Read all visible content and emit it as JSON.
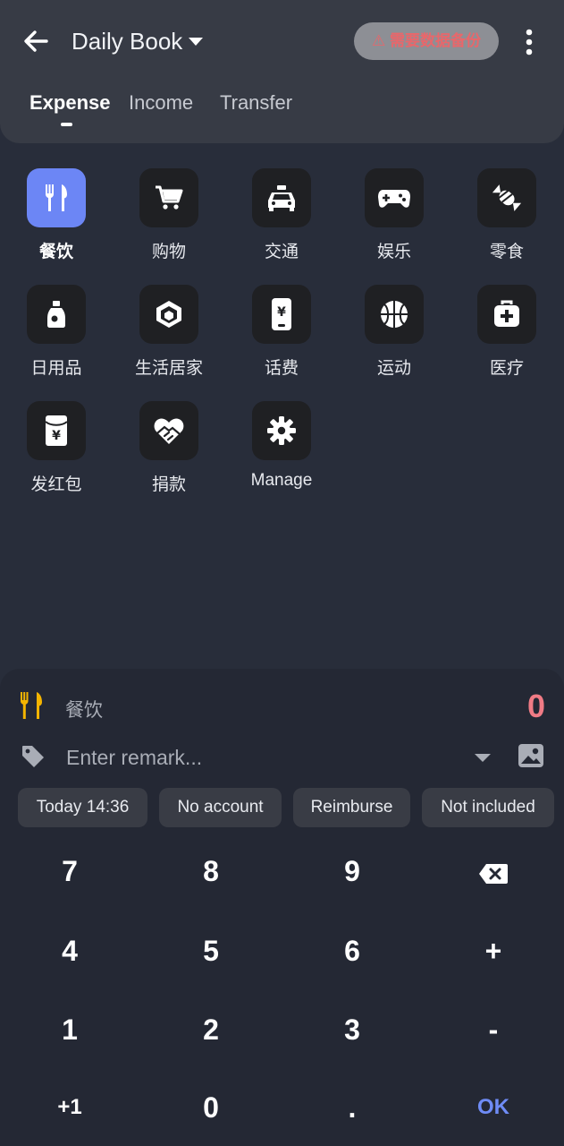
{
  "header": {
    "title": "Daily Book",
    "backup_badge": "⚠ 需要数据备份",
    "tabs": [
      {
        "label": "Expense",
        "active": true
      },
      {
        "label": "Income",
        "active": false
      },
      {
        "label": "Transfer",
        "active": false
      }
    ]
  },
  "categories": [
    {
      "label": "餐饮",
      "icon": "utensils-icon",
      "selected": true
    },
    {
      "label": "购物",
      "icon": "shopping-cart-icon"
    },
    {
      "label": "交通",
      "icon": "taxi-icon"
    },
    {
      "label": "娱乐",
      "icon": "gamepad-icon"
    },
    {
      "label": "零食",
      "icon": "candy-icon"
    },
    {
      "label": "日用品",
      "icon": "bottle-icon"
    },
    {
      "label": "生活居家",
      "icon": "cube-icon"
    },
    {
      "label": "话费",
      "icon": "phone-bill-icon"
    },
    {
      "label": "运动",
      "icon": "basketball-icon"
    },
    {
      "label": "医疗",
      "icon": "medical-kit-icon"
    },
    {
      "label": "发红包",
      "icon": "red-envelope-icon"
    },
    {
      "label": "捐款",
      "icon": "heart-donate-icon"
    },
    {
      "label": "Manage",
      "icon": "gear-icon"
    }
  ],
  "entry": {
    "category": "餐饮",
    "amount": "0",
    "remark_placeholder": "Enter remark..."
  },
  "chips": [
    "Today 14:36",
    "No account",
    "Reimburse",
    "Not included"
  ],
  "keypad": {
    "k7": "7",
    "k8": "8",
    "k9": "9",
    "k4": "4",
    "k5": "5",
    "k6": "6",
    "plus": "+",
    "k1": "1",
    "k2": "2",
    "k3": "3",
    "minus": "-",
    "plus_one": "+1",
    "k0": "0",
    "dot": ".",
    "ok": "OK"
  },
  "colors": {
    "accent": "#6c86f5",
    "amount": "#f07b85",
    "warning": "#e8676b",
    "category_icon": "#f4b400"
  }
}
